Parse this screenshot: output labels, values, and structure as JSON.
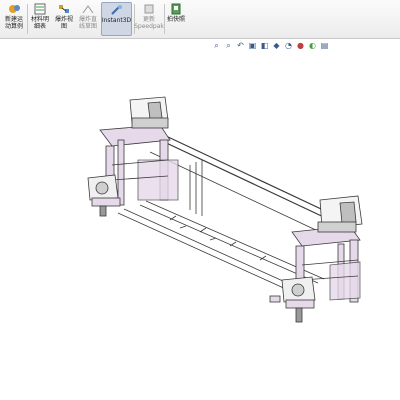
{
  "ribbon": {
    "buttons": [
      {
        "label": "新建运\n动算例",
        "icon": "new-motion-study-icon"
      },
      {
        "label": "材料明\n细表",
        "icon": "bill-of-materials-icon"
      },
      {
        "label": "爆炸视\n图",
        "icon": "exploded-view-icon"
      },
      {
        "label": "爆炸直\n线草图",
        "icon": "explode-line-sketch-icon"
      },
      {
        "label": "Instant3D",
        "icon": "instant3d-icon"
      },
      {
        "label": "更新\nSpeedpak",
        "icon": "update-speedpak-icon"
      },
      {
        "label": "拍快照",
        "icon": "take-snapshot-icon"
      }
    ]
  },
  "heads_up_toolbar": {
    "icons": [
      "zoom-to-fit-icon",
      "zoom-to-area-icon",
      "previous-view-icon",
      "section-view-icon",
      "view-orientation-icon",
      "display-style-icon",
      "hide-show-items-icon",
      "edit-appearance-icon",
      "apply-scene-icon",
      "view-settings-icon"
    ]
  },
  "colors": {
    "frame": "#e6d9ea",
    "frame_stroke": "#3a3a3a",
    "ribbon_bg": "#ececec",
    "active_button": "#cfd6e4"
  }
}
